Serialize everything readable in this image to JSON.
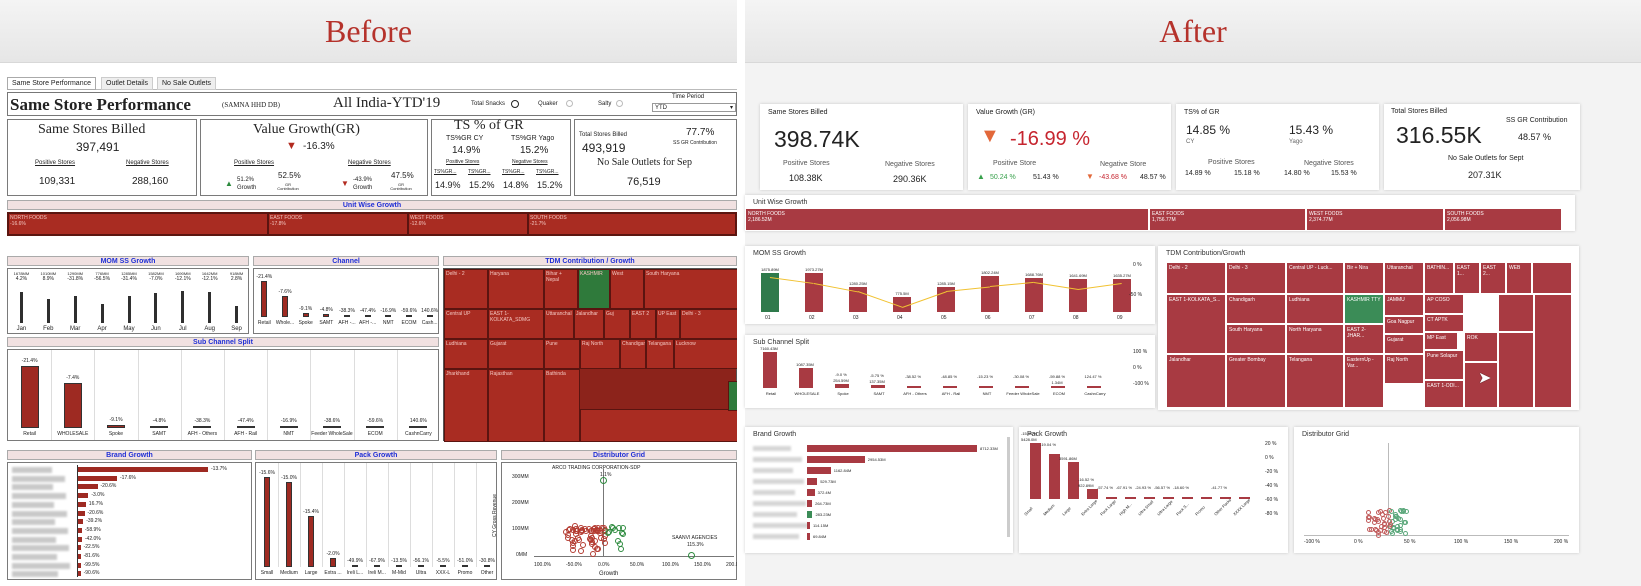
{
  "before": {
    "header": "Before",
    "tabs": [
      "Same Store Performance",
      "Outlet Details",
      "No Sale Outlets"
    ],
    "title": "Same Store Performance",
    "title_sub": "(SAMNA HHD DB)",
    "region": "All India-YTD'19",
    "filters": [
      "Total Snacks",
      "Quaker",
      "Salty"
    ],
    "time_period_label": "Time Period",
    "time_period_value": "YTD",
    "billed": {
      "title": "Same Stores Billed",
      "value": "397,491",
      "pos_label": "Positive Stores",
      "neg_label": "Negative Stores",
      "pos": "109,331",
      "neg": "288,160"
    },
    "vg": {
      "title": "Value Growth(GR)",
      "value": "-16.3%",
      "pos_label": "Positive Stores",
      "neg_label": "Negative Stores",
      "pos_growth": "51.2%",
      "pos_growth_label": "Growth",
      "pos_contrib": "52.5%",
      "contrib_label": "GR Contribution",
      "neg_growth": "-43.9%",
      "neg_growth_label": "Growth",
      "neg_contrib": "47.5%"
    },
    "ts": {
      "title": "TS % of GR",
      "cy_label": "TS%GR CY",
      "yago_label": "TS%GR Yago",
      "cy": "14.9%",
      "yago": "15.2%",
      "pos_label": "Positive Stores",
      "neg_label": "Negative Stores",
      "sub": [
        "TS%GR...",
        "TS%GR...",
        "TS%GR...",
        "TS%GR..."
      ],
      "vals": [
        "14.9%",
        "15.2%",
        "14.8%",
        "15.2%"
      ]
    },
    "total": {
      "label": "Total Stores Billed",
      "value": "493,919",
      "pct": "77.7%",
      "pct_label": "SS GR Contribution",
      "nosale_label": "No Sale Outlets for Sep",
      "nosale": "76,519"
    },
    "unit_title": "Unit Wise Growth",
    "units": [
      {
        "name": "NORTH FOODS",
        "v": "-16.6%"
      },
      {
        "name": "EAST FOODS",
        "v": "-17.8%"
      },
      {
        "name": "WEST FOODS",
        "v": "-12.6%"
      },
      {
        "name": "SOUTH FOODS",
        "v": "-21.7%"
      }
    ],
    "mom_title": "MOM SS Growth",
    "mom": {
      "months": [
        "Jan",
        "Feb",
        "Mar",
        "Apr",
        "May",
        "Jun",
        "Jul",
        "Aug",
        "Sep"
      ],
      "vals": [
        "1678MM",
        "1010MM",
        "1290MM",
        "776MM",
        "1285MM",
        "1582MM",
        "1690MM",
        "1642MM",
        "918MM"
      ],
      "pcts": [
        "4.2%",
        "8.9%",
        "-31.8%",
        "-56.5%",
        "-31.4%",
        "-7.0%",
        "-12.1%",
        "-12.1%",
        "2.8%"
      ],
      "levels": [
        0.82,
        0.62,
        0.7,
        0.5,
        0.7,
        0.78,
        0.84,
        0.82,
        0.45
      ]
    },
    "channel_title": "Channel",
    "channel": {
      "cats": [
        "Retail",
        "Whole...",
        "Spoke",
        "SAMT",
        "AFH -...",
        "AFH -...",
        "NMT",
        "ECOM",
        "Cash..."
      ],
      "pcts": [
        "-21.4%",
        "-7.6%",
        "-9.1%",
        "-4.8%",
        "-38.3%",
        "-47.4%",
        "-16.9%",
        "-59.6%",
        "140.6%"
      ],
      "levels": [
        1,
        0.58,
        0.1,
        0.08,
        0.06,
        0.05,
        0.04,
        0.04,
        0.04
      ]
    },
    "tdm_title": "TDM Contribution / Growth",
    "tdm": [
      "Delhi - 2",
      "Haryana",
      "Bihar + Nepal",
      "KASHMIR",
      "West",
      "South Haryana",
      "Central UP",
      "EAST 1-KOLKATA_SDMG",
      "Uttaranchal",
      "Jalandhar",
      "Guj",
      "EAST 2",
      "UP East",
      "Delhi - 3",
      "Ludhiana",
      "Gujarat",
      "Pune",
      "Raj North",
      "Chandigarh",
      "Telangana",
      "Lucknow",
      "Jharkhand",
      "Rajasthan",
      "Bathinda"
    ],
    "subch_title": "Sub Channel Split",
    "subch": {
      "cats": [
        "Retail",
        "WHOLESALE",
        "Spoke",
        "SAMT",
        "AFH - Others",
        "AFH - Rail",
        "NMT",
        "Feeder WholeSale",
        "ECOM",
        "CashnCarry"
      ],
      "pcts": [
        "-21.4%",
        "-7.4%",
        "-9.1%",
        "-4.8%",
        "-38.3%",
        "-47.4%",
        "-16.9%",
        "-38.6%",
        "-59.6%",
        "140.6%"
      ],
      "levels": [
        1,
        0.72,
        0.05,
        0.04,
        0.03,
        0.03,
        0.03,
        0.03,
        0.03,
        0.03
      ]
    },
    "brand_title": "Brand Growth",
    "brand": {
      "pcts": [
        "-13.7%",
        "-17.6%",
        "-20.6%",
        "-3.0%",
        "16.7%",
        "-20.6%",
        "-39.2%",
        "-58.9%",
        "-42.0%",
        "-22.5%",
        "-81.6%",
        "-99.5%",
        "-90.6%"
      ],
      "levels": [
        1,
        0.3,
        0.15,
        0.08,
        0.06,
        0.05,
        0.04,
        0.03,
        0.03,
        0.02,
        0.02,
        0.02,
        0.02
      ]
    },
    "pack_title": "Pack Growth",
    "pack": {
      "cats": [
        "Small",
        "Medium",
        "Large",
        "Extra ...",
        "Ireli L...",
        "Ireli M...",
        "M-Mid",
        "Ultra",
        "XXX-L",
        "Promo",
        "Other"
      ],
      "pcts": [
        "-15.6%",
        "-15.0%",
        "-15.4%",
        "-2.0%",
        "-49.9%",
        "-67.9%",
        "-13.5%",
        "-56.1%",
        "-5.5%",
        "-51.0%",
        "-30.8%"
      ],
      "levels": [
        0.98,
        0.92,
        0.55,
        0.1,
        0.02,
        0.02,
        0.02,
        0.02,
        0.02,
        0.02,
        0.02
      ]
    },
    "dist_title": "Distributor Grid",
    "dist": {
      "y_label": "CY Gross Revenue",
      "yticks": [
        "300MM",
        "200MM",
        "100MM",
        "0MM"
      ],
      "xticks": [
        "100.0%",
        "-50.0%",
        "0.0%",
        "50.0%",
        "100.0%",
        "150.0%",
        "200.0%"
      ],
      "x_label": "Growth",
      "ann1": "ARCO TRADING CORPORATION-SDP",
      "ann1_v": "1.1%",
      "ann2": "SAANVI AGENCIES",
      "ann2_v": "115.3%"
    }
  },
  "after": {
    "header": "After",
    "billed": {
      "title": "Same Stores Billed",
      "value": "398.74K",
      "pos_label": "Positive Stores",
      "neg_label": "Negative Stores",
      "pos": "108.38K",
      "neg": "290.36K"
    },
    "vg": {
      "title": "Value Growth (GR)",
      "value": "-16.99 %",
      "pos_label": "Positive Store",
      "neg_label": "Negative Store",
      "pos_growth": "50.24 %",
      "pos_contrib": "51.43 %",
      "neg_growth": "-43.68 %",
      "neg_contrib": "48.57 %"
    },
    "ts": {
      "title": "TS% of GR",
      "cy": "14.85 %",
      "cy_label": "CY",
      "yago": "15.43 %",
      "yago_label": "Yago",
      "pos_label": "Positive Stores",
      "neg_label": "Negative Stores",
      "vals": [
        "14.89 %",
        "15.18 %",
        "14.80 %",
        "15.53 %"
      ]
    },
    "total": {
      "label": "Total Stores Billed",
      "value": "316.55K",
      "contrib_label": "SS GR Contribution",
      "contrib": "48.57 %",
      "nosale_label": "No Sale Outlets for Sept",
      "nosale": "207.31K"
    },
    "unit_title": "Unit Wise Growth",
    "units": [
      {
        "name": "NORTH FOODS",
        "v": "2,186.52M"
      },
      {
        "name": "EAST FOODS",
        "v": "1,756.77M"
      },
      {
        "name": "WEST FOODS",
        "v": "2,374.77M"
      },
      {
        "name": "SOUTH FOODS",
        "v": "2,056.98M"
      }
    ],
    "mom_title": "MOM SS Growth",
    "mom": {
      "months": [
        "01",
        "02",
        "03",
        "04",
        "05",
        "06",
        "07",
        "08",
        "09"
      ],
      "vals": [
        "1875.89M",
        "1973.27M",
        "1280.25M",
        "775.5M",
        "1285.15M",
        "1802.24M",
        "1688.76M",
        "1641.69M",
        "1635.27M"
      ],
      "levels": [
        0.82,
        0.82,
        0.52,
        0.32,
        0.52,
        0.74,
        0.7,
        0.68,
        0.68
      ],
      "axis": [
        "0 %",
        "-50 %"
      ]
    },
    "subch_title": "Sub Channel Split",
    "subch": {
      "cats": [
        "Retail",
        "WHOLESALE",
        "Spoke",
        "SAMT",
        "AFH - Others",
        "AFH - Rail",
        "NMT",
        "Feeder WholeSale",
        "ECOM",
        "CashnCarry"
      ],
      "pcts": [
        "",
        "",
        "-9.0 %",
        "-5.75 %",
        "-38.52 %",
        "-48.85 %",
        "-15.23 %",
        "-30.08 %",
        "-59.88 %",
        "124.47 %"
      ],
      "vals": [
        "7160.43M",
        "1087.35M",
        "254.59M",
        "137.35M",
        "",
        "",
        "",
        "",
        "1.34M",
        ""
      ],
      "levels": [
        1,
        0.55,
        0.1,
        0.08,
        0.05,
        0.04,
        0.04,
        0.03,
        0.03,
        0.03
      ],
      "axis": [
        "100 %",
        "0 %",
        "-100 %"
      ]
    },
    "tdm_title": "TDM Contribution/Growth",
    "tdm": [
      "Delhi - 2",
      "Delhi - 3",
      "Central UP - Luck...",
      "Bir + Nira",
      "Uttaranchal",
      "BATHIN...",
      "EAST 1...",
      "EAST 2...",
      "WEB",
      "Chandigarh",
      "Ludhiana",
      "KASHMIR TTY",
      "JAMMU",
      "Goa Nagpur",
      "AP COSO",
      "CT APTK",
      "EAST 1-KOLKATA_S...",
      "South Haryana",
      "North Haryana",
      "EAST 2-JHAR...",
      "Gujarat",
      "MP East",
      "Jalandhar",
      "Greater Bombay",
      "Telangana",
      "EasternUp - Var...",
      "Raj North",
      "Pune Solapur",
      "ROK",
      "EAST 1-ODI..."
    ],
    "brand_title": "Brand Growth",
    "brand": {
      "vals": [
        "8712.33M",
        "2954.53M",
        "1162.84M",
        "529.73M",
        "372.4M",
        "264.73M",
        "283.23M",
        "114.15M",
        "69.84M"
      ],
      "levels": [
        1,
        0.34,
        0.14,
        0.06,
        0.045,
        0.03,
        0.032,
        0.015,
        0.01
      ]
    },
    "pack_title": "Pack Growth",
    "pack": {
      "cats": [
        "Small",
        "Medium",
        "Large",
        "Extra Large",
        "Pack Large",
        "High M...",
        "Ultra Small",
        "Ultra Large",
        "Pack S...",
        "Promo",
        "Other Packs",
        "XXXX Large"
      ],
      "pcts": [
        "-15.96 %",
        "-19.04 %",
        "",
        "-16.52 %",
        "-57.74 %",
        "-67.91 %",
        "-24.93 %",
        "-56.57 %",
        "-18.60 %",
        "",
        "-41.77 %",
        ""
      ],
      "vals": [
        "5428.0M",
        "",
        "3591.86M",
        "922.89M",
        "",
        "",
        "",
        "",
        "",
        "",
        "",
        ""
      ],
      "levels": [
        1,
        0.8,
        0.66,
        0.17,
        0.04,
        0.03,
        0.03,
        0.02,
        0.02,
        0.02,
        0.02,
        0.02
      ],
      "axis": [
        "20 %",
        "0 %",
        "-20 %",
        "-40 %",
        "-60 %",
        "-80 %"
      ]
    },
    "dist_title": "Distributor Grid",
    "dist": {
      "xticks": [
        "-100 %",
        "0 %",
        "50 %",
        "100 %",
        "150 %",
        "200 %"
      ]
    }
  }
}
